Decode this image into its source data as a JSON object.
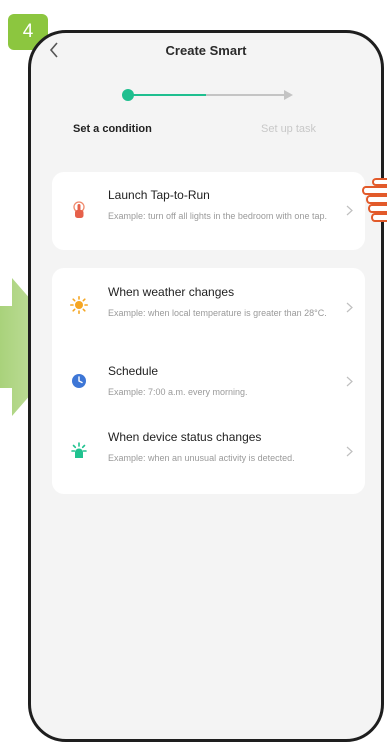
{
  "badge": {
    "step_number": "4",
    "color": "#8cc63f"
  },
  "header": {
    "title": "Create Smart",
    "back_icon": "chevron-left-icon"
  },
  "steps": [
    {
      "label": "Set a condition",
      "active": true
    },
    {
      "label": "Set up task",
      "active": false
    }
  ],
  "colors": {
    "accent": "#1fbf8f",
    "progress_inactive": "#c4c4c4"
  },
  "tap_to_run": {
    "title": "Launch Tap-to-Run",
    "description": "Example: turn off all lights in the bedroom with one tap.",
    "icon": "tap-hand-icon"
  },
  "conditions": [
    {
      "title": "When weather changes",
      "description": "Example: when local temperature is greater than 28°C.",
      "icon": "sun-icon"
    },
    {
      "title": "Schedule",
      "description": "Example: 7:00 a.m. every morning.",
      "icon": "clock-icon"
    },
    {
      "title": "When device status changes",
      "description": "Example: when an unusual activity is detected.",
      "icon": "device-status-icon"
    }
  ]
}
